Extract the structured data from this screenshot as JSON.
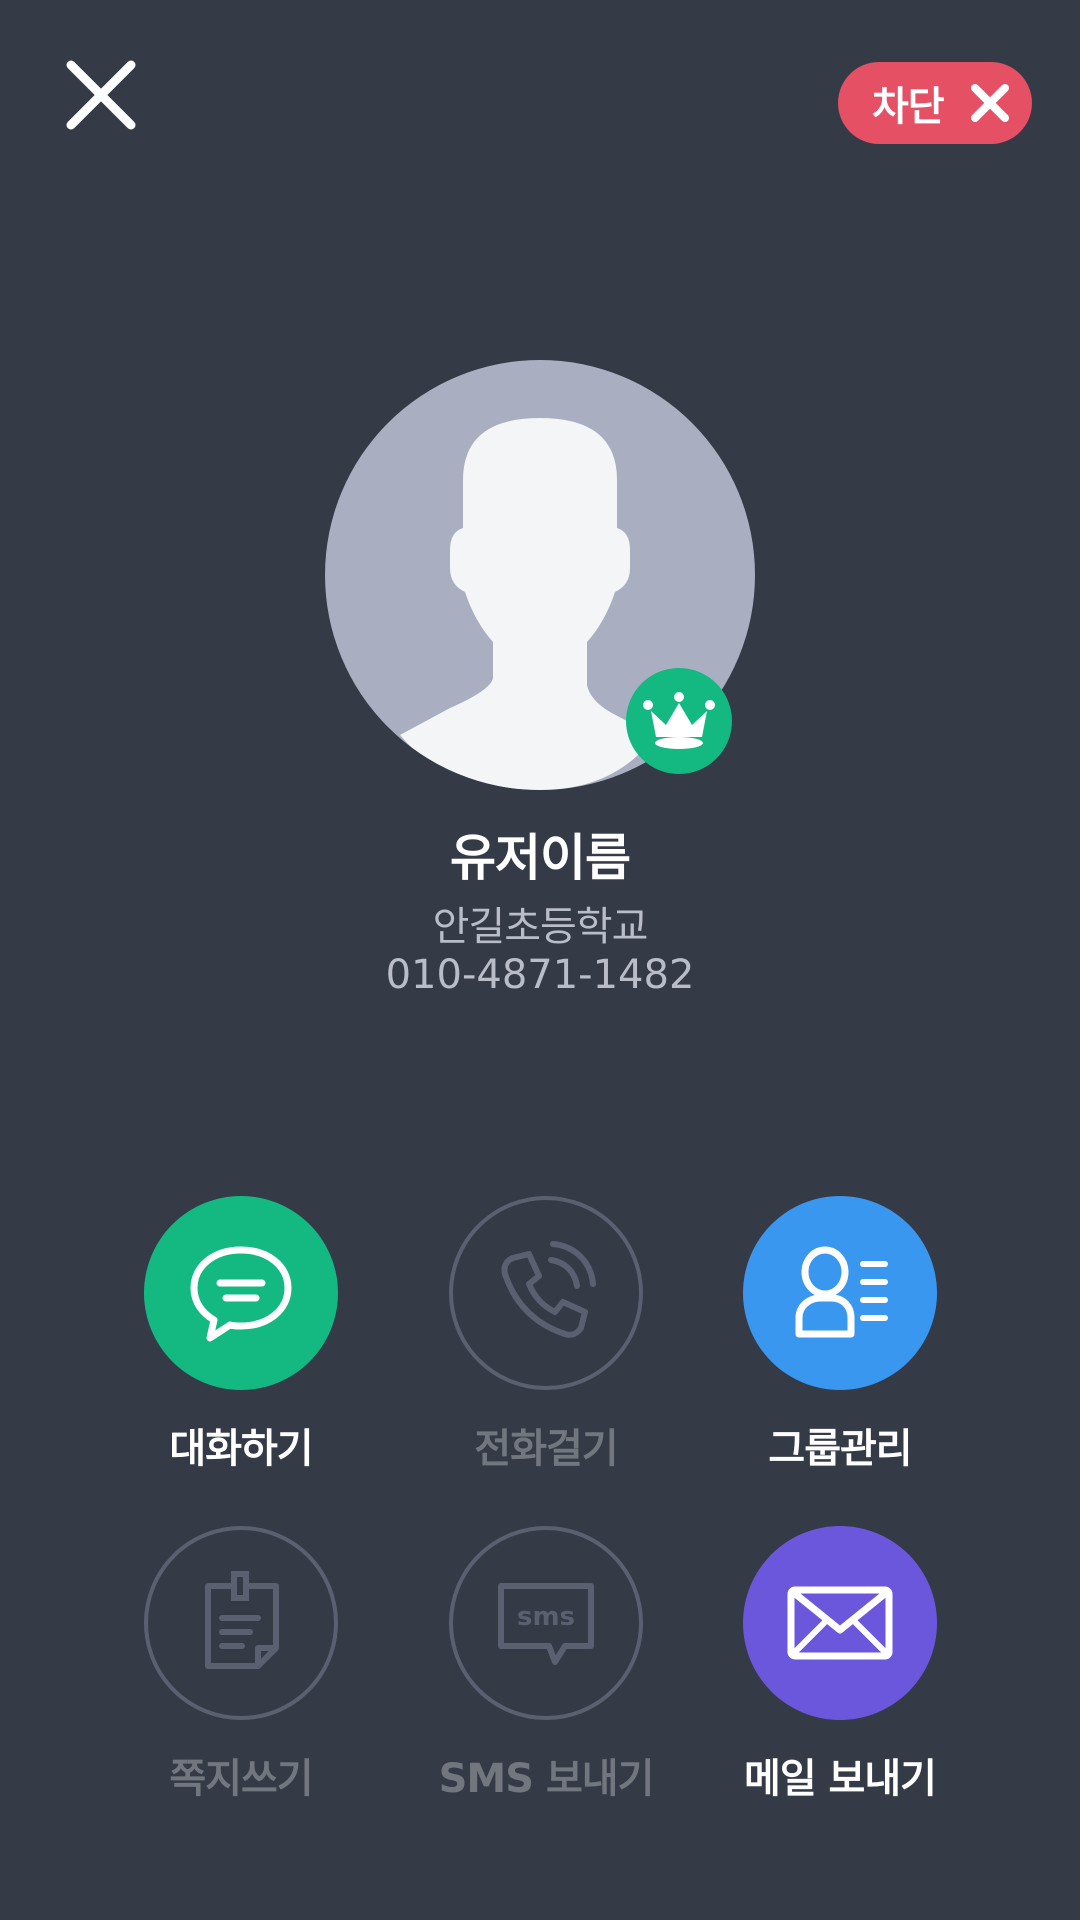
{
  "header": {
    "close_icon": "close-icon",
    "block_label": "차단",
    "block_icon": "x-icon",
    "block_color": "#e55065"
  },
  "profile": {
    "name": "유저이름",
    "school": "안길초등학교",
    "phone": "010-4871-1482",
    "avatar_icon": "person-silhouette-icon",
    "badge_icon": "crown-icon",
    "badge_color": "#13b981"
  },
  "actions": [
    {
      "label": "대화하기",
      "icon": "chat-bubble-icon",
      "enabled": true,
      "color": "#13b981"
    },
    {
      "label": "전화걸기",
      "icon": "phone-icon",
      "enabled": false,
      "color": ""
    },
    {
      "label": "그룹관리",
      "icon": "group-manage-icon",
      "enabled": true,
      "color": "#3a97ef"
    },
    {
      "label": "쪽지쓰기",
      "icon": "note-icon",
      "enabled": false,
      "color": ""
    },
    {
      "label": "SMS 보내기",
      "icon": "sms-icon",
      "enabled": false,
      "color": ""
    },
    {
      "label": "메일 보내기",
      "icon": "mail-icon",
      "enabled": true,
      "color": "#6b57dc"
    }
  ],
  "icons": {
    "sms_text": "sms"
  },
  "colors": {
    "background": "#353a47",
    "disabled_stroke": "#5b6070",
    "disabled_text": "#71767f"
  }
}
